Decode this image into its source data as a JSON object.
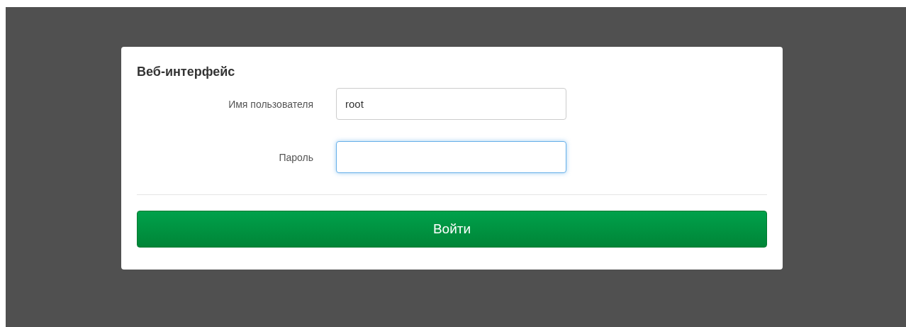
{
  "card": {
    "title": "Веб-интерфейс",
    "fields": [
      {
        "label": "Имя пользователя",
        "value": "root",
        "focused": false
      },
      {
        "label": "Пароль",
        "focused": true
      }
    ],
    "submit_button": "Войти"
  }
}
